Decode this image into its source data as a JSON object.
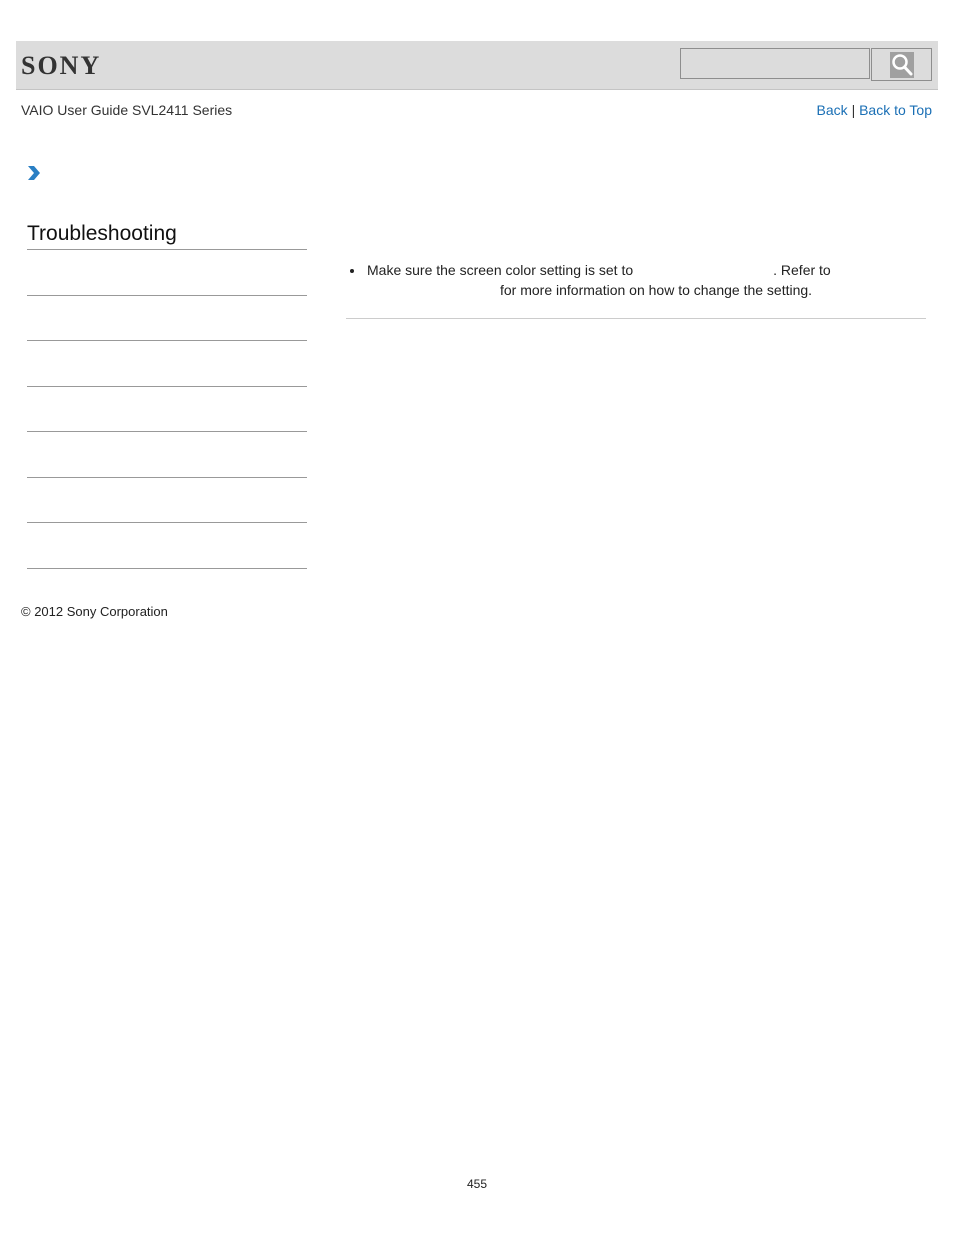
{
  "header": {
    "brand": "SONY",
    "search": {
      "value": "",
      "placeholder": ""
    },
    "search_icon": "magnifier-icon"
  },
  "subheader": {
    "guide_title": "VAIO User Guide SVL2411 Series",
    "back_label": "Back",
    "separator": "|",
    "back_to_top_label": "Back to Top"
  },
  "breadcrumb": {
    "icon": "chevron-right-icon"
  },
  "sidebar": {
    "title": "Troubleshooting"
  },
  "content": {
    "bullet_part1": "Make sure the screen color setting is set to",
    "bullet_part2": ". Refer to",
    "bullet_part3": "for more information on how to change the setting."
  },
  "footer": {
    "copyright": "© 2012 Sony Corporation",
    "page_number": "455"
  },
  "colors": {
    "link": "#1a6fb5",
    "header_bg": "#dcdcdc",
    "chevron": "#2a7fc4"
  }
}
